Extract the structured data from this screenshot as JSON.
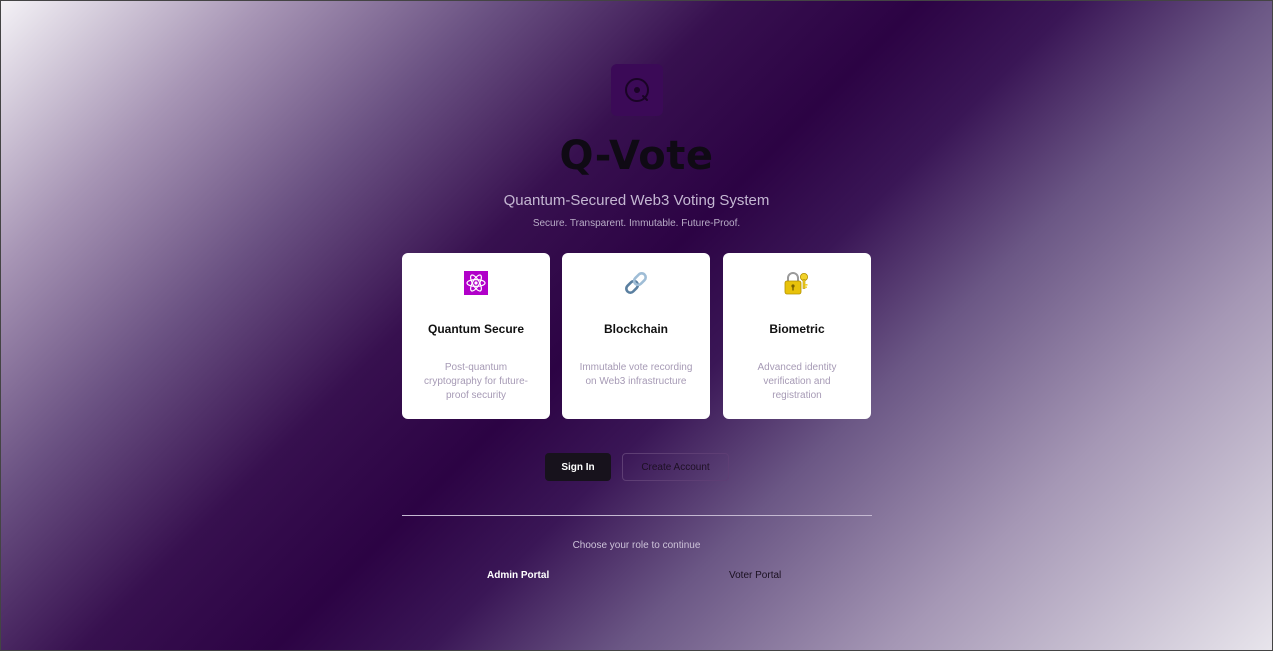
{
  "app": {
    "title": "Q-Vote",
    "subtitle": "Quantum-Secured Web3 Voting System",
    "tagline": "Secure. Transparent. Immutable. Future-Proof.",
    "logo_icon": "quantum-logo-icon"
  },
  "features": [
    {
      "icon": "atom-icon",
      "title": "Quantum Secure",
      "description": "Post-quantum cryptography for future-proof security"
    },
    {
      "icon": "link-icon",
      "title": "Blockchain",
      "description": "Immutable vote recording on Web3 infrastructure"
    },
    {
      "icon": "lock-key-icon",
      "title": "Biometric",
      "description": "Advanced identity verification and registration"
    }
  ],
  "actions": {
    "sign_in": "Sign In",
    "create_account": "Create Account"
  },
  "roles": {
    "prompt": "Choose your role to continue",
    "admin": "Admin Portal",
    "voter": "Voter Portal"
  },
  "colors": {
    "brand": "#3b0a57",
    "background_dark": "#2c0344",
    "atom_badge": "#b100c9",
    "button_primary": "#17121c"
  }
}
